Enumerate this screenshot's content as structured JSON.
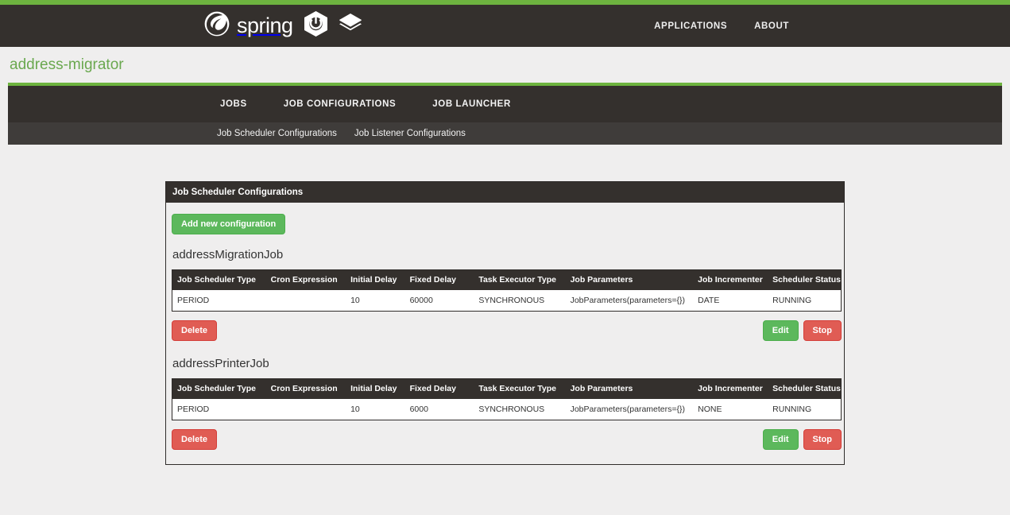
{
  "masthead": {
    "brand_name": "spring",
    "nav": [
      {
        "label": "APPLICATIONS"
      },
      {
        "label": "ABOUT"
      }
    ]
  },
  "app": {
    "title": "address-migrator"
  },
  "primary_nav": [
    {
      "label": "JOBS"
    },
    {
      "label": "JOB CONFIGURATIONS"
    },
    {
      "label": "JOB LAUNCHER"
    }
  ],
  "secondary_nav": [
    {
      "label": "Job Scheduler Configurations"
    },
    {
      "label": "Job Listener Configurations"
    }
  ],
  "panel": {
    "heading": "Job Scheduler Configurations",
    "add_button": "Add new configuration",
    "columns": [
      "Job Scheduler Type",
      "Cron Expression",
      "Initial Delay",
      "Fixed Delay",
      "Task Executor Type",
      "Job Parameters",
      "Job Incrementer",
      "Scheduler Status"
    ],
    "actions": {
      "delete": "Delete",
      "edit": "Edit",
      "stop": "Stop"
    },
    "jobs": [
      {
        "name": "addressMigrationJob",
        "row": {
          "scheduler_type": "PERIOD",
          "cron_expression": "",
          "initial_delay": "10",
          "fixed_delay": "60000",
          "task_executor_type": "SYNCHRONOUS",
          "job_parameters": "JobParameters(parameters={})",
          "job_incrementer": "DATE",
          "scheduler_status": "RUNNING"
        }
      },
      {
        "name": "addressPrinterJob",
        "row": {
          "scheduler_type": "PERIOD",
          "cron_expression": "",
          "initial_delay": "10",
          "fixed_delay": "6000",
          "task_executor_type": "SYNCHRONOUS",
          "job_parameters": "JobParameters(parameters={})",
          "job_incrementer": "NONE",
          "scheduler_status": "RUNNING"
        }
      }
    ]
  },
  "colors": {
    "spring_green": "#6db33f",
    "dark_bar": "#34302d",
    "secondary_bar": "#3f3c3a",
    "page_bg": "#efeeee",
    "success": "#5cb85c",
    "danger": "#e05c54",
    "title_green": "#6aa84f"
  }
}
